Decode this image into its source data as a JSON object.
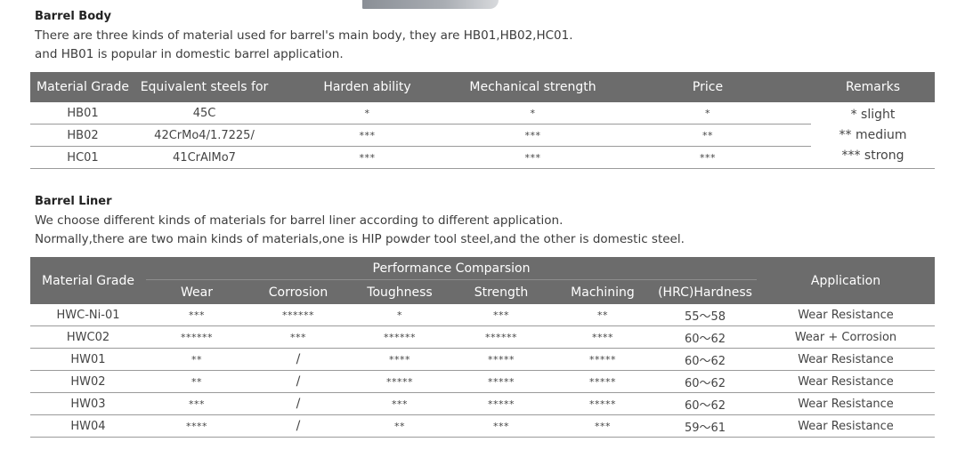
{
  "barrel_body": {
    "heading": "Barrel Body",
    "line1": "There are three kinds of material used for barrel's main body, they are HB01,HB02,HC01.",
    "line2": "and HB01 is popular in domestic barrel application.",
    "table": {
      "headers": [
        "Material Grade",
        "Equivalent steels for",
        "Harden ability",
        "Mechanical strength",
        "Price",
        "Remarks"
      ],
      "rows": [
        [
          "HB01",
          "45C",
          "*",
          "*",
          "*"
        ],
        [
          "HB02",
          "42CrMo4/1.7225/",
          "***",
          "***",
          "**"
        ],
        [
          "HC01",
          "41CrAlMo7",
          "***",
          "***",
          "***"
        ]
      ],
      "remarks": [
        "*  slight",
        "** medium",
        "*** strong"
      ]
    }
  },
  "barrel_liner": {
    "heading": "Barrel Liner",
    "line1": "We choose different kinds of materials for barrel liner according to different application.",
    "line2": "Normally,there are two main kinds of materials,one is HIP powder tool steel,and the other is domestic steel.",
    "table": {
      "group_header": "Performance Comparsion",
      "col_material": "Material Grade",
      "col_application": "Application",
      "sub_headers": [
        "Wear",
        "Corrosion",
        "Toughness",
        "Strength",
        "Machining",
        "(HRC)Hardness"
      ],
      "rows": [
        [
          "HWC-Ni-01",
          "***",
          "******",
          "*",
          "***",
          "**",
          "55～58",
          "Wear Resistance"
        ],
        [
          "HWC02",
          "******",
          "***",
          "******",
          "******",
          "****",
          "60～62",
          "Wear + Corrosion"
        ],
        [
          "HW01",
          "**",
          "/",
          "****",
          "*****",
          "*****",
          "60～62",
          "Wear Resistance"
        ],
        [
          "HW02",
          "**",
          "/",
          "*****",
          "*****",
          "*****",
          "60～62",
          "Wear Resistance"
        ],
        [
          "HW03",
          "***",
          "/",
          "***",
          "*****",
          "*****",
          "60～62",
          "Wear Resistance"
        ],
        [
          "HW04",
          "****",
          "/",
          "**",
          "***",
          "***",
          "59～61",
          "Wear Resistance"
        ]
      ]
    }
  }
}
